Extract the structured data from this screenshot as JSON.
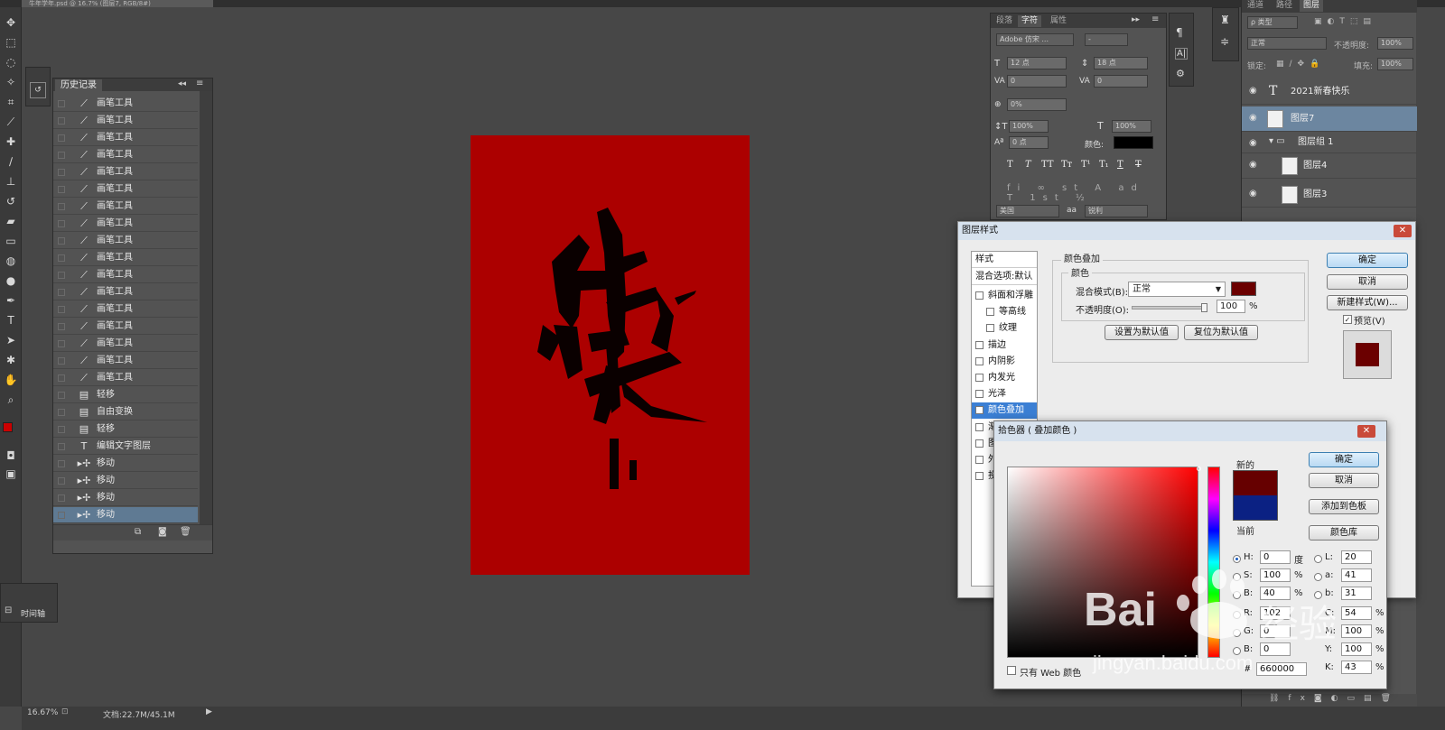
{
  "document_tab": "牛年学年.psd @ 16.7% (图层7, RGB/8#)",
  "history": {
    "title": "历史记录",
    "items": [
      {
        "icon": "brush-icon",
        "label": "画笔工具"
      },
      {
        "icon": "brush-icon",
        "label": "画笔工具"
      },
      {
        "icon": "brush-icon",
        "label": "画笔工具"
      },
      {
        "icon": "brush-icon",
        "label": "画笔工具"
      },
      {
        "icon": "brush-icon",
        "label": "画笔工具"
      },
      {
        "icon": "brush-icon",
        "label": "画笔工具"
      },
      {
        "icon": "brush-icon",
        "label": "画笔工具"
      },
      {
        "icon": "brush-icon",
        "label": "画笔工具"
      },
      {
        "icon": "brush-icon",
        "label": "画笔工具"
      },
      {
        "icon": "brush-icon",
        "label": "画笔工具"
      },
      {
        "icon": "brush-icon",
        "label": "画笔工具"
      },
      {
        "icon": "brush-icon",
        "label": "画笔工具"
      },
      {
        "icon": "brush-icon",
        "label": "画笔工具"
      },
      {
        "icon": "brush-icon",
        "label": "画笔工具"
      },
      {
        "icon": "brush-icon",
        "label": "画笔工具"
      },
      {
        "icon": "brush-icon",
        "label": "画笔工具"
      },
      {
        "icon": "brush-icon",
        "label": "画笔工具"
      },
      {
        "icon": "document-icon",
        "label": "轻移"
      },
      {
        "icon": "document-icon",
        "label": "自由变换"
      },
      {
        "icon": "document-icon",
        "label": "轻移"
      },
      {
        "icon": "type-icon",
        "label": "编辑文字图层"
      },
      {
        "icon": "move-icon",
        "label": "移动"
      },
      {
        "icon": "move-icon",
        "label": "移动"
      },
      {
        "icon": "move-icon",
        "label": "移动"
      },
      {
        "icon": "move-icon",
        "label": "移动"
      }
    ]
  },
  "timeline": {
    "label": "时间轴"
  },
  "character": {
    "tabs": [
      "段落",
      "字符",
      "属性"
    ],
    "font_family": "Adobe 仿宋 ...",
    "font_style": "-",
    "size": "12 点",
    "leading": "18 点",
    "kerning": "0",
    "tracking": "0",
    "tsume": "0%",
    "vscale": "100%",
    "hscale": "100%",
    "baseline": "0 点",
    "color_label": "颜色:",
    "language": "美国",
    "aa": "锐利"
  },
  "layers": {
    "tabs": [
      "通道",
      "路径",
      "图层"
    ],
    "filter_label": "ρ 类型",
    "blend_mode": "正常",
    "opacity_label": "不透明度:",
    "opacity_value": "100%",
    "lock_label": "锁定:",
    "fill_label": "填充:",
    "fill_value": "100%",
    "items": [
      {
        "name": "2021新春快乐",
        "kind": "text"
      },
      {
        "name": "图层7",
        "kind": "pixel",
        "selected": true
      },
      {
        "name": "图层组 1",
        "kind": "group"
      },
      {
        "name": "图层4",
        "kind": "pixel"
      },
      {
        "name": "图层3",
        "kind": "pixel"
      }
    ]
  },
  "layer_style": {
    "title": "图层样式",
    "styles_header": "样式",
    "blend_default": "混合选项:默认",
    "styles": [
      {
        "label": "斜面和浮雕",
        "checked": false,
        "indent": false
      },
      {
        "label": "等高线",
        "checked": false,
        "indent": true
      },
      {
        "label": "纹理",
        "checked": false,
        "indent": true
      },
      {
        "label": "描边",
        "checked": false,
        "indent": false
      },
      {
        "label": "内阴影",
        "checked": false,
        "indent": false
      },
      {
        "label": "内发光",
        "checked": false,
        "indent": false
      },
      {
        "label": "光泽",
        "checked": false,
        "indent": false
      },
      {
        "label": "颜色叠加",
        "checked": true,
        "indent": false,
        "selected": true
      },
      {
        "label": "渐",
        "checked": false,
        "indent": false
      },
      {
        "label": "图",
        "checked": false,
        "indent": false
      },
      {
        "label": "外",
        "checked": false,
        "indent": false
      },
      {
        "label": "投",
        "checked": false,
        "indent": false
      }
    ],
    "section_title": "颜色叠加",
    "group_title": "颜色",
    "blend_label": "混合模式(B):",
    "blend_value": "正常",
    "opacity_label": "不透明度(O):",
    "opacity_value": "100",
    "percent": "%",
    "set_default": "设置为默认值",
    "reset_default": "复位为默认值",
    "ok": "确定",
    "cancel": "取消",
    "new_style": "新建样式(W)...",
    "preview": "预览(V)",
    "overlay_color": "#6b0000"
  },
  "color_picker": {
    "title": "拾色器 ( 叠加颜色 )",
    "new_label": "新的",
    "current_label": "当前",
    "new_color": "#660000",
    "current_color": "#0b2183",
    "ok": "确定",
    "cancel": "取消",
    "add_swatch": "添加到色板",
    "color_library": "颜色库",
    "fields": {
      "H": "0",
      "S": "100",
      "B": "40",
      "R": "102",
      "G": "0",
      "Bb": "0",
      "L": "20",
      "a": "41",
      "b": "31",
      "C": "54",
      "M": "100",
      "Y": "100",
      "K": "43"
    },
    "deg": "度",
    "pct": "%",
    "hex_label": "#",
    "hex": "660000",
    "web_only": "只有 Web 颜色"
  },
  "status": {
    "zoom": "16.67%",
    "doc_info": "文档:22.7M/45.1M"
  },
  "watermark": {
    "brand": "Bai",
    "brand2": "经验",
    "url": "jingyan.baidu.com"
  },
  "colors": {
    "foreground": "#cc0000",
    "background": "#ffffff",
    "canvas": "#ac0000"
  }
}
